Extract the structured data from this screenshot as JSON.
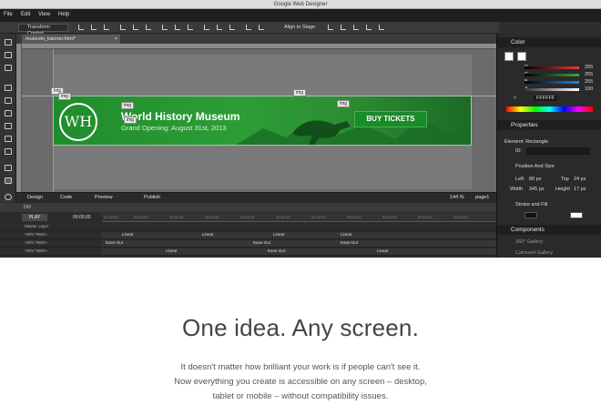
{
  "window": {
    "title": "Google Web Designer"
  },
  "menu": [
    "File",
    "Edit",
    "View",
    "Help"
  ],
  "toolbar": {
    "transform_control": "Transform Control",
    "align_to_stage": "Align to Stage"
  },
  "document_tab": {
    "name": "museum_banner.html*",
    "close": "×"
  },
  "banner": {
    "logo_text": "WH",
    "title": "World History Museum",
    "subtitle": "Grand Opening: August 31st, 2013",
    "button": "BUY TICKETS",
    "img_tag": "img"
  },
  "designbar": {
    "design": "Design",
    "code": "Code",
    "preview": "Preview",
    "publish": "Publish",
    "zoom": "144 %",
    "page": "page1"
  },
  "timeline": {
    "breadcrumb": "DIV",
    "play": "PLAY",
    "time": "00:00:00",
    "ticks": [
      "00:00:00",
      "00:00:50",
      "00:01:00",
      "00:01:50",
      "00:02:00",
      "00:02:50",
      "00:03:00",
      "00:03:50",
      "00:04:00",
      "00:04:50",
      "00:05:00"
    ],
    "layers": [
      {
        "label": "Master Layer",
        "eases": []
      },
      {
        "label": "<DIV:?IMG>",
        "eases": [
          "Linear",
          "Linear",
          "Linear",
          "Linear"
        ]
      },
      {
        "label": "<DIV:?IMG>",
        "eases": [
          "Ease-Out",
          "Ease-Out",
          "Ease-Out"
        ]
      },
      {
        "label": "<DIV:?IMG>",
        "eases": [
          "Linear",
          "Ease-Out",
          "Linear"
        ]
      }
    ]
  },
  "panels": {
    "color": {
      "title": "Color",
      "channels": [
        {
          "name": "R",
          "value": "255",
          "color": "#e53935"
        },
        {
          "name": "G",
          "value": "255",
          "color": "#43a047"
        },
        {
          "name": "B",
          "value": "255",
          "color": "#1e88e5"
        },
        {
          "name": "A",
          "value": "100",
          "color": "#ffffff"
        }
      ],
      "hex": "FFFFFF"
    },
    "properties": {
      "title": "Properties",
      "element": "Element: Rectangle",
      "id_label": "ID:",
      "pos_size_title": "Position And Size",
      "left_label": "Left",
      "left_value": "80 px",
      "top_label": "Top",
      "top_value": "24 px",
      "width_label": "Width",
      "width_value": "345 px",
      "height_label": "Height",
      "height_value": "17 px",
      "stroke_fill_title": "Stroke and Fill"
    },
    "components": {
      "title": "Components",
      "items": [
        "360° Gallery",
        "Carousel Gallery"
      ]
    }
  },
  "hero": {
    "headline": "One idea. Any screen.",
    "body": "It doesn't matter how brilliant your work is if people can't see it. Now everything you create is accessible on any screen – desktop, tablet or mobile – without compatibility issues."
  },
  "colors": {
    "banner_green": "#2c9e36",
    "app_dark": "#2e2e2e",
    "hero_text": "#444444"
  }
}
